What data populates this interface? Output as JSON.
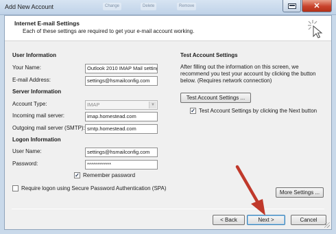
{
  "window": {
    "title": "Add New Account",
    "background_tabs": [
      "Change",
      "Delete",
      "Remove"
    ]
  },
  "header": {
    "title": "Internet E-mail Settings",
    "subtitle": "Each of these settings are required to get your e-mail account working."
  },
  "user_info": {
    "heading": "User Information",
    "name_label": "Your Name:",
    "name_value": "Outlook 2010 IMAP Mail setting",
    "email_label": "E-mail Address:",
    "email_value": "settings@hsmailconfig.com"
  },
  "server_info": {
    "heading": "Server Information",
    "account_type_label": "Account Type:",
    "account_type_value": "IMAP",
    "incoming_label": "Incoming mail server:",
    "incoming_value": "imap.homestead.com",
    "outgoing_label": "Outgoing mail server (SMTP):",
    "outgoing_value": "smtp.homestead.com"
  },
  "logon_info": {
    "heading": "Logon Information",
    "username_label": "User Name:",
    "username_value": "settings@hsmailconfig.com",
    "password_label": "Password:",
    "password_value": "************",
    "remember_label": "Remember password",
    "remember_checked": true,
    "spa_label": "Require logon using Secure Password Authentication (SPA)",
    "spa_checked": false
  },
  "test_settings": {
    "heading": "Test Account Settings",
    "description_lines": [
      "After filling out the information on this screen, we",
      "recommend you test your account by clicking the button",
      "below. (Requires network connection)"
    ],
    "test_button": "Test Account Settings ...",
    "auto_test_label": "Test Account Settings by clicking the Next button",
    "auto_test_checked": true
  },
  "buttons": {
    "more_settings": "More Settings ...",
    "back": "< Back",
    "next": "Next >",
    "cancel": "Cancel"
  },
  "colors": {
    "annotation_arrow": "#c0392b",
    "close_button": "#c8422b"
  }
}
